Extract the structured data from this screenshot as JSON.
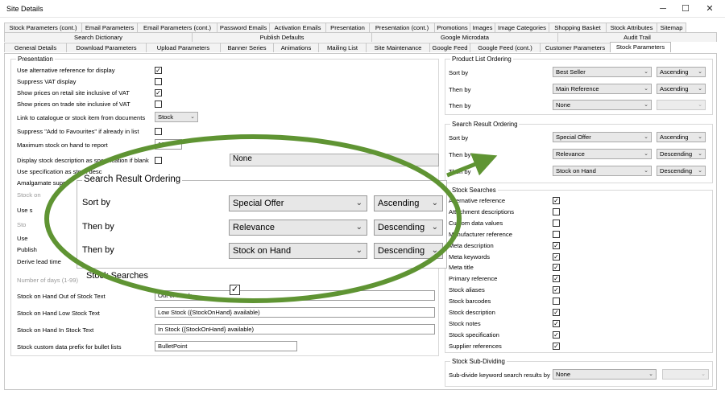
{
  "window": {
    "title": "Site Details",
    "min": "─",
    "max": "☐",
    "close": "✕"
  },
  "tabs_row1": [
    "Stock Parameters (cont.)",
    "Email Parameters",
    "Email Parameters (cont.)",
    "Password Emails",
    "Activation Emails",
    "Presentation",
    "Presentation (cont.)",
    "Promotions",
    "Images",
    "Image Categories",
    "Shopping Basket",
    "Stock Attributes",
    "Sitemap"
  ],
  "tabs_row2": [
    "Search Dictionary",
    "Publish Defaults",
    "Google Microdata",
    "Audit Trail"
  ],
  "tabs_row3": [
    "General Details",
    "Download Parameters",
    "Upload Parameters",
    "Banner Series",
    "Animations",
    "Mailing List",
    "Site Maintenance",
    "Google Feed",
    "Google Feed (cont.)",
    "Customer Parameters",
    "Stock Parameters"
  ],
  "presentation": {
    "title": "Presentation",
    "rows": [
      {
        "label": "Use alternative reference for display",
        "checked": true
      },
      {
        "label": "Suppress VAT display",
        "checked": false
      },
      {
        "label": "Show prices on retail site inclusive of VAT",
        "checked": true
      },
      {
        "label": "Show prices on trade site inclusive of VAT",
        "checked": false
      }
    ],
    "link_label": "Link to catalogue or stock item from documents",
    "link_value": "Stock",
    "suppress_fav_label": "Suppress \"Add to Favourites\" if already in list",
    "suppress_fav_checked": false,
    "max_stock_label": "Maximum stock on hand to report",
    "max_stock_value": "100",
    "display_desc_label": "Display stock description as specification if blank",
    "use_spec_label": "Use specification as stock desc",
    "amalgamate_label": "Amalgamate suppl",
    "stock_on_label": "Stock on",
    "use_s_label": "Use s",
    "sto_label": "Sto",
    "use2_label": "Use",
    "publish_label": "Publish",
    "derive_label": "Derive lead time",
    "number_days_label": "Number of days (1-99)",
    "none_value": "None",
    "out_label": "Stock on Hand Out of Stock Text",
    "out_value": "Out of Stock",
    "low_label": "Stock on Hand Low Stock Text",
    "low_value": "Low Stock ({StockOnHand} available)",
    "in_label": "Stock on Hand In Stock Text",
    "in_value": "In Stock ({StockOnHand} available)",
    "prefix_label": "Stock custom data prefix for bullet lists",
    "prefix_value": "BulletPoint"
  },
  "product_list_ordering": {
    "title": "Product List Ordering",
    "rows": [
      {
        "label": "Sort by",
        "value": "Best Seller",
        "dir": "Ascending"
      },
      {
        "label": "Then by",
        "value": "Main Reference",
        "dir": "Ascending"
      },
      {
        "label": "Then by",
        "value": "None",
        "dir": ""
      }
    ]
  },
  "search_result_ordering": {
    "title": "Search Result Ordering",
    "rows": [
      {
        "label": "Sort by",
        "value": "Special Offer",
        "dir": "Ascending"
      },
      {
        "label": "Then by",
        "value": "Relevance",
        "dir": "Descending"
      },
      {
        "label": "Then by",
        "value": "Stock on Hand",
        "dir": "Descending"
      }
    ]
  },
  "stock_searches": {
    "title": "Stock Searches",
    "zoom_title": "Stock Searches",
    "items": [
      {
        "label": "Alternative reference",
        "checked": true
      },
      {
        "label": "Attachment descriptions",
        "checked": false
      },
      {
        "label": "Custom data values",
        "checked": false
      },
      {
        "label": "Manufacturer reference",
        "checked": false
      },
      {
        "label": "Meta description",
        "checked": true
      },
      {
        "label": "Meta keywords",
        "checked": true
      },
      {
        "label": "Meta title",
        "checked": true
      },
      {
        "label": "Primary reference",
        "checked": true
      },
      {
        "label": "Stock aliases",
        "checked": true
      },
      {
        "label": "Stock barcodes",
        "checked": false
      },
      {
        "label": "Stock description",
        "checked": true
      },
      {
        "label": "Stock notes",
        "checked": true
      },
      {
        "label": "Stock specification",
        "checked": true
      },
      {
        "label": "Supplier references",
        "checked": true
      }
    ]
  },
  "sub_dividing": {
    "title": "Stock Sub-Dividing",
    "label": "Sub-divide keyword search results by",
    "value": "None"
  },
  "colors": {
    "accent_green": "#5f9433",
    "check": "#333333"
  }
}
